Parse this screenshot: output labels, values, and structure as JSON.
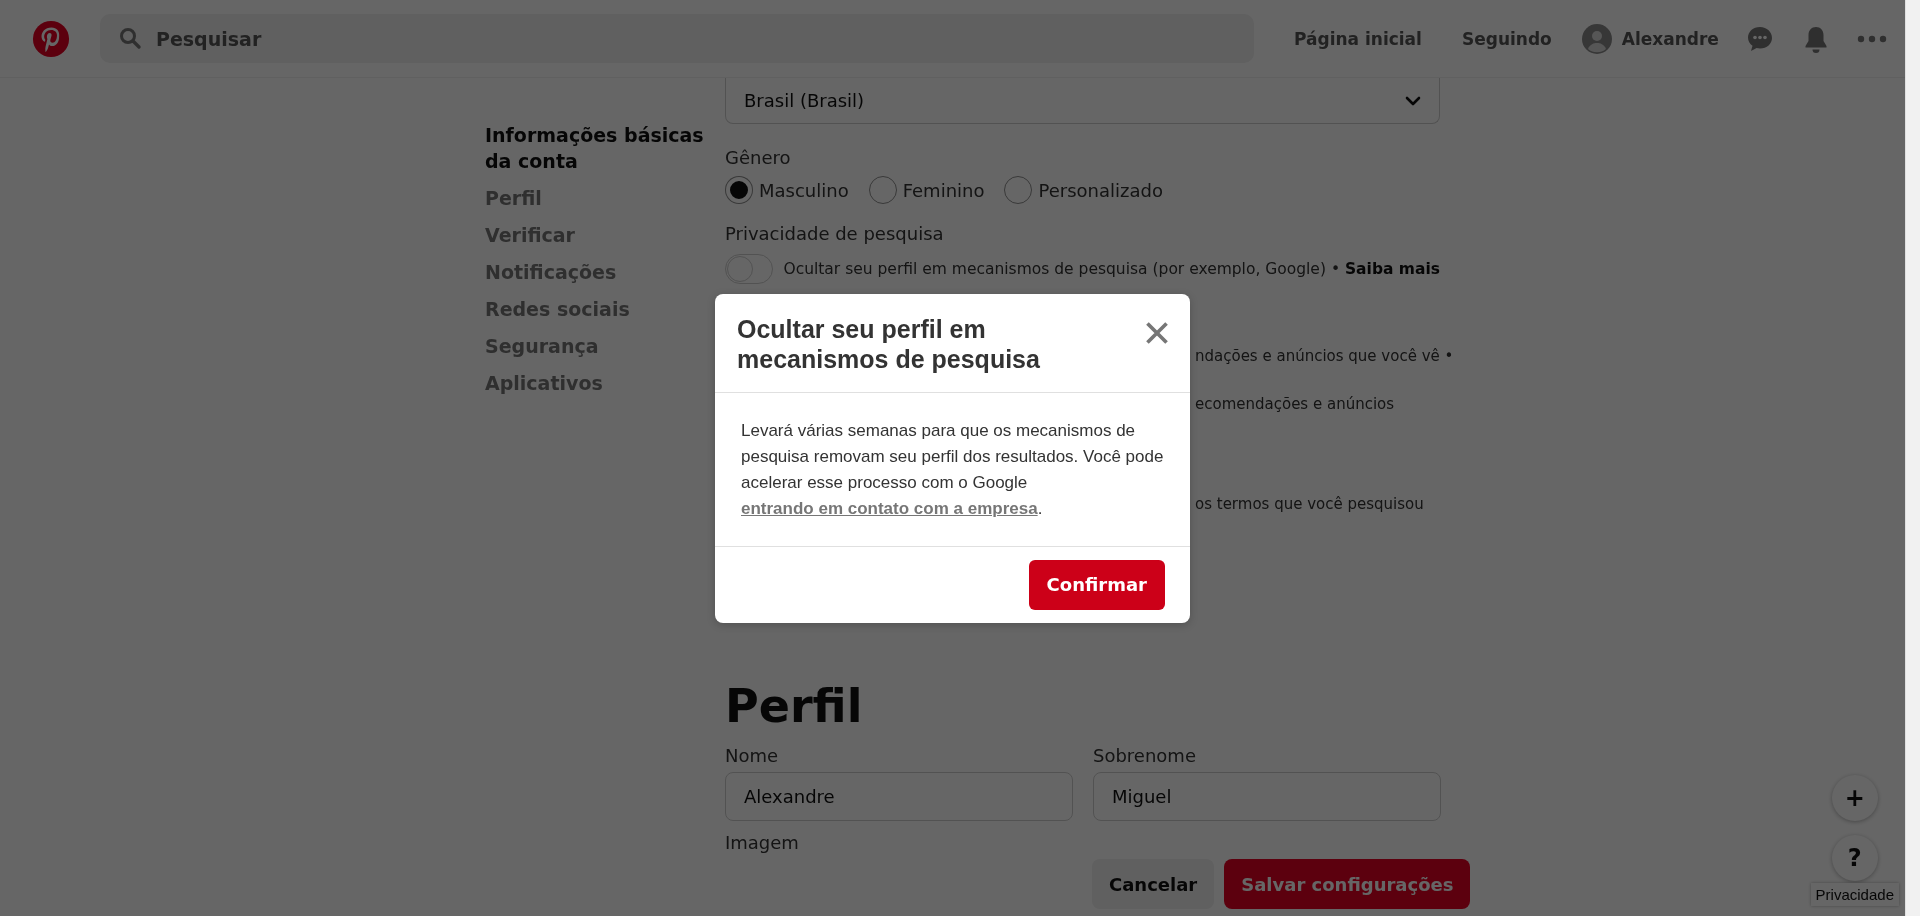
{
  "header": {
    "search": {
      "placeholder": "Pesquisar"
    },
    "nav": [
      {
        "label": "Página inicial"
      },
      {
        "label": "Seguindo"
      }
    ],
    "user": {
      "name": "Alexandre"
    }
  },
  "sidebar": {
    "items": [
      {
        "label": "Informações básicas da conta",
        "selected": true
      },
      {
        "label": "Perfil",
        "selected": false
      },
      {
        "label": "Verificar",
        "selected": false
      },
      {
        "label": "Notificações",
        "selected": false
      },
      {
        "label": "Redes sociais",
        "selected": false
      },
      {
        "label": "Segurança",
        "selected": false
      },
      {
        "label": "Aplicativos",
        "selected": false
      }
    ]
  },
  "account": {
    "country": {
      "value": "Brasil (Brasil)"
    },
    "gender": {
      "label": "Gênero",
      "options": [
        {
          "label": "Masculino",
          "selected": true
        },
        {
          "label": "Feminino",
          "selected": false
        },
        {
          "label": "Personalizado",
          "selected": false
        }
      ]
    },
    "search_privacy": {
      "label": "Privacidade de pesquisa",
      "on": false,
      "description": "Ocultar seu perfil em mecanismos de pesquisa (por exemplo, Google) • ",
      "link": "Saiba mais"
    },
    "partly_hidden_texts": [
      "ndações e anúncios que você vê •",
      "ecomendações e anúncios",
      "os termos que você pesquisou"
    ]
  },
  "profile": {
    "heading": "Perfil",
    "fields": [
      {
        "label": "Nome",
        "value": "Alexandre"
      },
      {
        "label": "Sobrenome",
        "value": "Miguel"
      }
    ],
    "image_label": "Imagem"
  },
  "footer": {
    "cancel": "Cancelar",
    "save": "Salvar configurações"
  },
  "floating": {
    "buttons": [
      "+",
      "?"
    ],
    "privacy": "Privacidade"
  },
  "modal": {
    "title": "Ocultar seu perfil em mecanismos de pesquisa",
    "body": "Levará várias semanas para que os mecanismos de pesquisa removam seu perfil dos resultados. Você pode acelerar esse processo com o Google ",
    "link": "entrando em contato com a empresa",
    "body_end": ".",
    "confirm": "Confirmar"
  }
}
